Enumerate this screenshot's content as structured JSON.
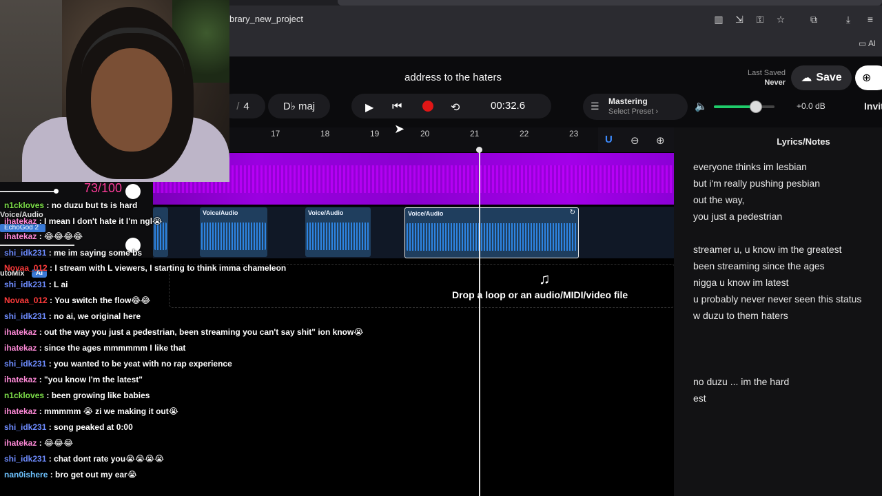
{
  "browser": {
    "url": "brary_new_project",
    "icons": [
      "sidebar-icon",
      "install-app-icon",
      "key-icon",
      "star-icon",
      "extensions-icon",
      "download-icon",
      "queue-icon"
    ],
    "bookmark": "Al"
  },
  "header": {
    "project_title": "address to the haters",
    "last_saved_label": "Last Saved",
    "last_saved_value": "Never",
    "save_label": "Save",
    "invite_label": "Invit"
  },
  "toolbar": {
    "bars_prefix": "/",
    "bars_value": "4",
    "key": "D♭ maj",
    "time": "00:32.6",
    "mastering_label": "Mastering",
    "mastering_preset": "Select Preset ›",
    "volume_db": "+0.0 dB",
    "volume_level": 0.68
  },
  "ruler": {
    "ticks": [
      "17",
      "18",
      "19",
      "20",
      "21",
      "22",
      "23"
    ]
  },
  "tracks": {
    "clip_label": "Voice/Audio",
    "drop_text": "Drop a loop or an audio/MIDI/video file"
  },
  "lyrics": {
    "title": "Lyrics/Notes",
    "lines": [
      "everyone thinks im lesbian",
      "but i'm really pushing pesbian",
      "out the way,",
      "you just a pedestrian",
      "streamer u, u know im the greatest",
      "been streaming since the ages",
      "nigga u know im latest",
      "u probably never never seen this status",
      "w duzu to them haters",
      "no duzu ... im the hard",
      "est"
    ]
  },
  "overlay": {
    "volume_readout": "73/100",
    "voice_label": "Voice/Audio",
    "echogod": "EchoGod 2",
    "automix": "utoMix",
    "ai_badge": "AI"
  },
  "chat": [
    {
      "user": "n1ckloves",
      "color": "#7ee04a",
      "text": " : no duzu but ts is hard"
    },
    {
      "user": "ihatekaz",
      "color": "#ff8ad8",
      "text": " : I mean I don't hate it I'm ngl😭"
    },
    {
      "user": "ihatekaz",
      "color": "#ff8ad8",
      "text": " : 😂😂😂😂"
    },
    {
      "user": "shi_idk231",
      "color": "#6e8cff",
      "text": " : me im saying some bs"
    },
    {
      "user": "Novaa_012",
      "color": "#ff3b3b",
      "text": " : I stream with L viewers, I starting to think imma chameleon"
    },
    {
      "user": "shi_idk231",
      "color": "#6e8cff",
      "text": " : L ai"
    },
    {
      "user": "Novaa_012",
      "color": "#ff3b3b",
      "text": " : You switch the flow😂😂"
    },
    {
      "user": "shi_idk231",
      "color": "#6e8cff",
      "text": " : no ai, we original here"
    },
    {
      "user": "ihatekaz",
      "color": "#ff8ad8",
      "text": " : out the way you just a pedestrian, been streaming you can't say shit\" ion know😭"
    },
    {
      "user": "ihatekaz",
      "color": "#ff8ad8",
      "text": " : since the ages mmmmmm I like that"
    },
    {
      "user": "shi_idk231",
      "color": "#6e8cff",
      "text": " : you wanted to be yeat with no rap experience"
    },
    {
      "user": "ihatekaz",
      "color": "#ff8ad8",
      "text": " : \"you know I'm the latest\""
    },
    {
      "user": "n1ckloves",
      "color": "#7ee04a",
      "text": " : been growing like babies"
    },
    {
      "user": "ihatekaz",
      "color": "#ff8ad8",
      "text": " : mmmmm 😭 zi we making it out😭"
    },
    {
      "user": "shi_idk231",
      "color": "#6e8cff",
      "text": " : song peaked at 0:00"
    },
    {
      "user": "ihatekaz",
      "color": "#ff8ad8",
      "text": " : 😂😂😂"
    },
    {
      "user": "shi_idk231",
      "color": "#6e8cff",
      "text": " : chat dont rate you😭😭😭😭"
    },
    {
      "user": "nan0ishere",
      "color": "#6ec3ff",
      "text": " : bro get out my ear😭"
    }
  ]
}
